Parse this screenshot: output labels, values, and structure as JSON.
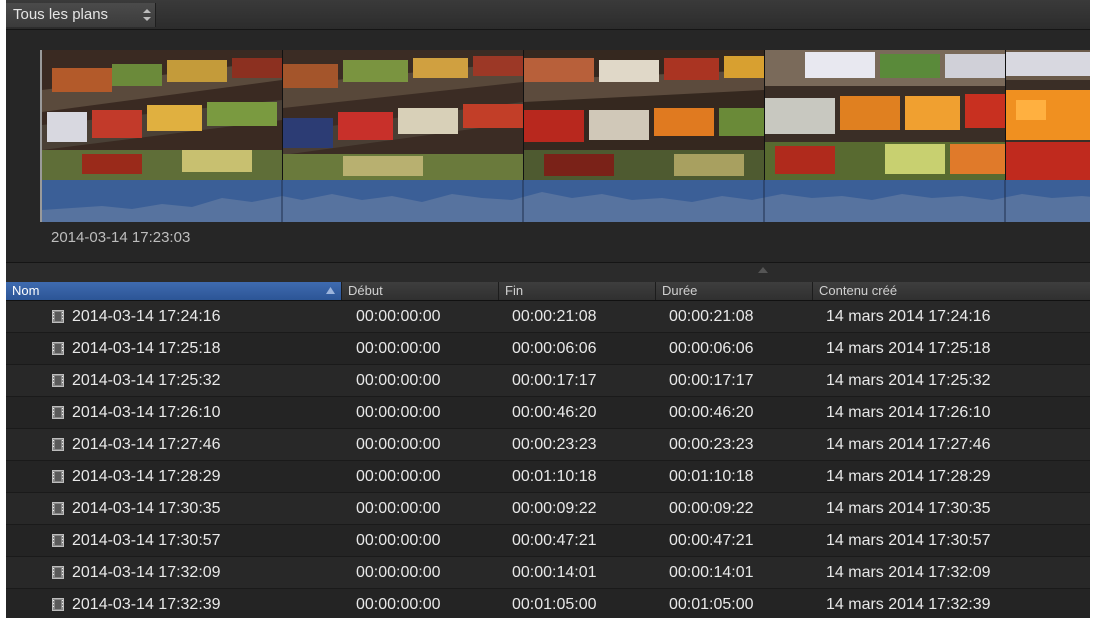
{
  "toolbar": {
    "filter_label": "Tous les plans"
  },
  "filmstrip": {
    "clip_time": "2014-03-14 17:23:03"
  },
  "table": {
    "columns": [
      "Nom",
      "Début",
      "Fin",
      "Durée",
      "Contenu créé"
    ],
    "rows": [
      [
        "2014-03-14 17:24:16",
        "00:00:00:00",
        "00:00:21:08",
        "00:00:21:08",
        "14 mars 2014 17:24:16"
      ],
      [
        "2014-03-14 17:25:18",
        "00:00:00:00",
        "00:00:06:06",
        "00:00:06:06",
        "14 mars 2014 17:25:18"
      ],
      [
        "2014-03-14 17:25:32",
        "00:00:00:00",
        "00:00:17:17",
        "00:00:17:17",
        "14 mars 2014 17:25:32"
      ],
      [
        "2014-03-14 17:26:10",
        "00:00:00:00",
        "00:00:46:20",
        "00:00:46:20",
        "14 mars 2014 17:26:10"
      ],
      [
        "2014-03-14 17:27:46",
        "00:00:00:00",
        "00:00:23:23",
        "00:00:23:23",
        "14 mars 2014 17:27:46"
      ],
      [
        "2014-03-14 17:28:29",
        "00:00:00:00",
        "00:01:10:18",
        "00:01:10:18",
        "14 mars 2014 17:28:29"
      ],
      [
        "2014-03-14 17:30:35",
        "00:00:00:00",
        "00:00:09:22",
        "00:00:09:22",
        "14 mars 2014 17:30:35"
      ],
      [
        "2014-03-14 17:30:57",
        "00:00:00:00",
        "00:00:47:21",
        "00:00:47:21",
        "14 mars 2014 17:30:57"
      ],
      [
        "2014-03-14 17:32:09",
        "00:00:00:00",
        "00:00:14:01",
        "00:00:14:01",
        "14 mars 2014 17:32:09"
      ],
      [
        "2014-03-14 17:32:39",
        "00:00:00:00",
        "00:01:05:00",
        "00:01:05:00",
        "14 mars 2014 17:32:39"
      ]
    ]
  },
  "colors": {
    "sort_header": "#3a66ab",
    "audio_waveform": "#3b5f97",
    "panel_background": "#232323"
  }
}
